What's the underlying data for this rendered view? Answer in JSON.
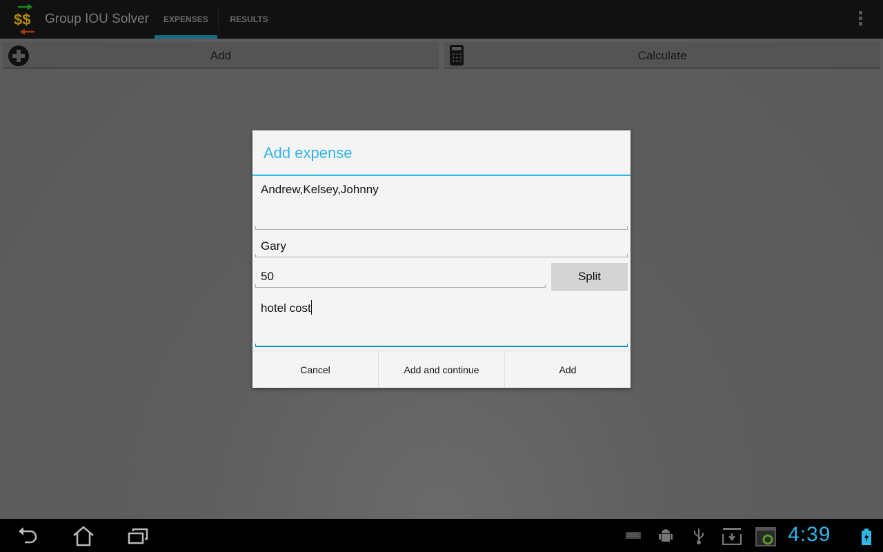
{
  "action_bar": {
    "app_title": "Group IOU Solver",
    "logo_icon": "dollar-exchange-icon",
    "tabs": [
      {
        "label": "EXPENSES",
        "selected": true
      },
      {
        "label": "RESULTS",
        "selected": false
      }
    ],
    "overflow_icon": "overflow-menu-icon"
  },
  "toolbar": {
    "add_label": "Add",
    "add_icon": "plus-circle-icon",
    "calculate_label": "Calculate",
    "calculate_icon": "calculator-icon"
  },
  "dialog": {
    "title": "Add expense",
    "fields": {
      "participants": "Andrew,Kelsey,Johnny",
      "payer": "Gary",
      "amount": "50",
      "description": "hotel cost"
    },
    "split_label": "Split",
    "buttons": {
      "cancel": "Cancel",
      "add_continue": "Add and continue",
      "add": "Add"
    },
    "accent_color": "#33b5e5"
  },
  "system_bar": {
    "nav": [
      "back-icon",
      "home-icon",
      "recent-apps-icon"
    ],
    "status_icons": [
      "keyboard-icon",
      "android-debug-icon",
      "usb-icon",
      "download-icon",
      "screenshot-sync-icon",
      "battery-charging-icon"
    ],
    "time": "4:39"
  }
}
